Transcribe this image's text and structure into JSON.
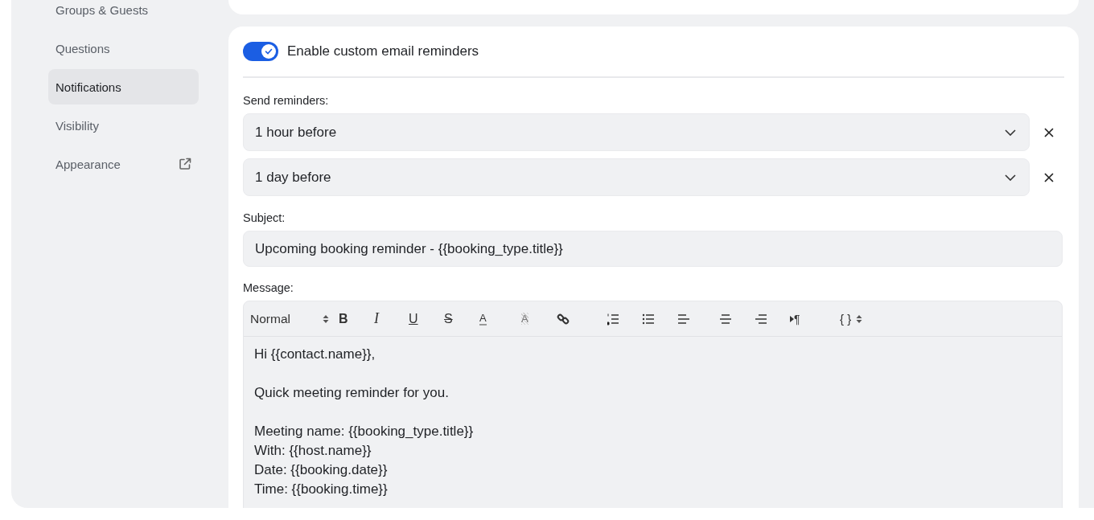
{
  "sidebar": {
    "items": [
      {
        "label": "Groups & Guests",
        "selected": false,
        "external": false
      },
      {
        "label": "Questions",
        "selected": false,
        "external": false
      },
      {
        "label": "Notifications",
        "selected": true,
        "external": false
      },
      {
        "label": "Visibility",
        "selected": false,
        "external": false
      },
      {
        "label": "Appearance",
        "selected": false,
        "external": true
      }
    ]
  },
  "reminders": {
    "toggle": {
      "label": "Enable custom email reminders",
      "on": true
    },
    "send_label": "Send reminders:",
    "reminders": [
      {
        "value": "1 hour before"
      },
      {
        "value": "1 day before"
      }
    ],
    "subject_label": "Subject:",
    "subject": {
      "value": "Upcoming booking reminder - {{booking_type.title}}"
    },
    "message_label": "Message:",
    "toolbar": [
      {
        "kind": "select",
        "label": "Normal"
      },
      {
        "kind": "bold",
        "label": "B"
      },
      {
        "kind": "italic",
        "label": "I"
      },
      {
        "kind": "underline",
        "label": "U"
      },
      {
        "kind": "strike",
        "label": "S"
      },
      {
        "kind": "color",
        "label": "A"
      },
      {
        "kind": "background",
        "label": "A"
      },
      {
        "kind": "link"
      },
      {
        "kind": "ordered-list"
      },
      {
        "kind": "bullet-list"
      },
      {
        "kind": "align-left"
      },
      {
        "kind": "align-center"
      },
      {
        "kind": "align-right"
      },
      {
        "kind": "direction",
        "label": "¶"
      },
      {
        "kind": "variables",
        "label": "{ }"
      }
    ],
    "message": [
      [
        "Hi {{contact.name}},"
      ],
      [
        "Quick meeting reminder for you."
      ],
      [
        "Meeting name: {{booking_type.title}}",
        "With: {{host.name}}",
        "Date: {{booking.date}}",
        "Time: {{booking.time}}"
      ]
    ]
  }
}
